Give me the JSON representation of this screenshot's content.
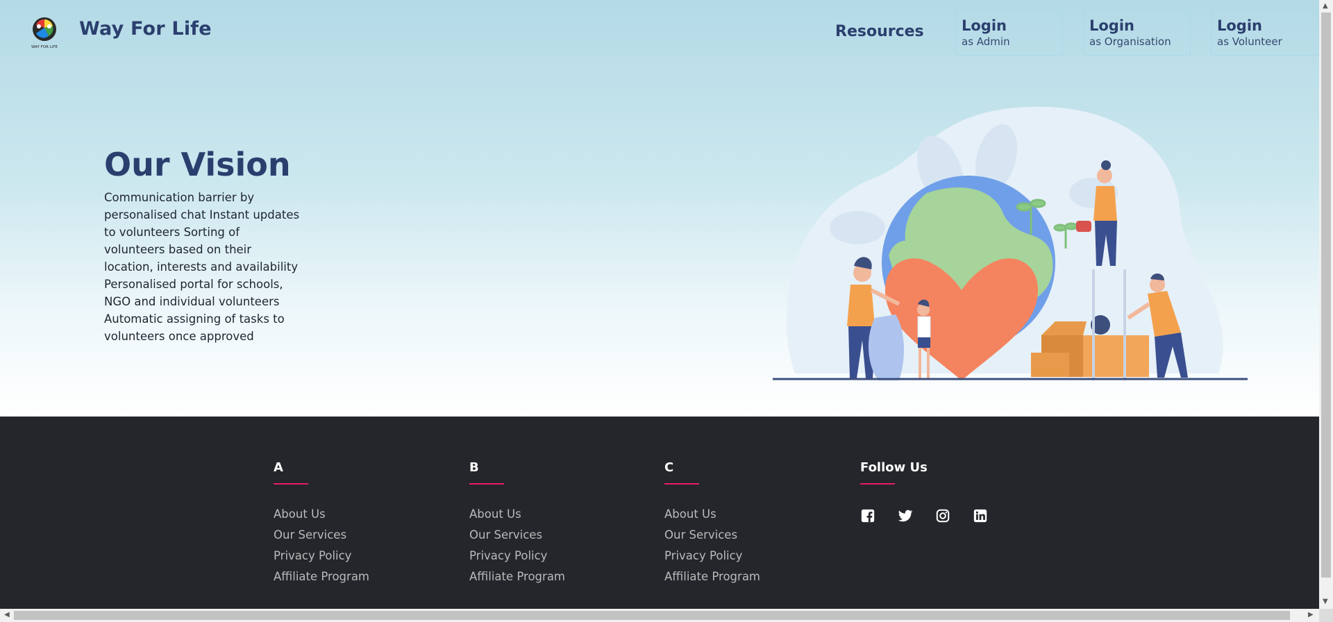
{
  "nav": {
    "brand": "Way For Life",
    "logo_text": "WAY FOR LIFE",
    "resources": "Resources",
    "logins": [
      {
        "title": "Login",
        "subtitle": "as Admin"
      },
      {
        "title": "Login",
        "subtitle": "as Organisation"
      },
      {
        "title": "Login",
        "subtitle": "as Volunteer"
      }
    ]
  },
  "hero": {
    "title": "Our Vision",
    "text": "Communication barrier by personalised chat Instant updates to volunteers Sorting of volunteers based on their location, interests and availability Personalised portal for schools, NGO and individual volunteers Automatic assigning of tasks to volunteers once approved"
  },
  "footer": {
    "columns": [
      {
        "heading": "A",
        "links": [
          "About Us",
          "Our Services",
          "Privacy Policy",
          "Affiliate Program"
        ]
      },
      {
        "heading": "B",
        "links": [
          "About Us",
          "Our Services",
          "Privacy Policy",
          "Affiliate Program"
        ]
      },
      {
        "heading": "C",
        "links": [
          "About Us",
          "Our Services",
          "Privacy Policy",
          "Affiliate Program"
        ]
      }
    ],
    "follow_heading": "Follow Us",
    "socials": [
      "facebook-icon",
      "twitter-icon",
      "instagram-icon",
      "linkedin-icon"
    ]
  },
  "colors": {
    "brand_navy": "#2b3f6e",
    "accent_pink": "#e91e63",
    "footer_bg": "#24262b",
    "hero_top": "#b3dae6"
  }
}
